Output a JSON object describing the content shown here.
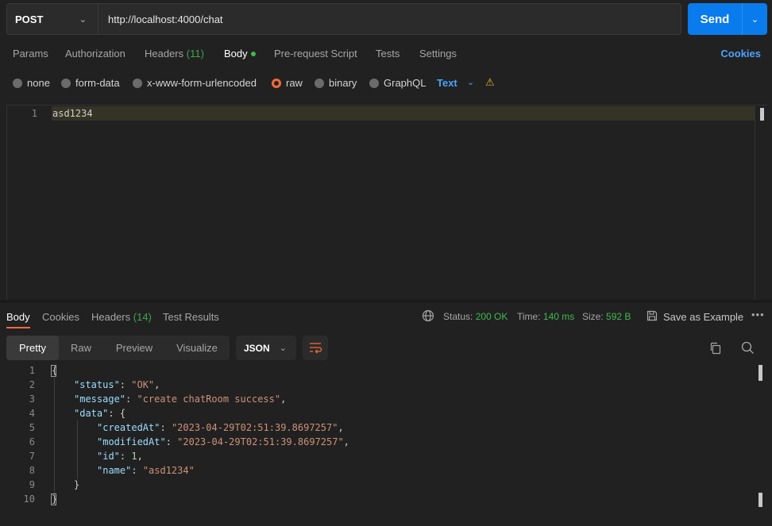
{
  "request": {
    "method": "POST",
    "url": "http://localhost:4000/chat",
    "send_label": "Send"
  },
  "request_tabs": [
    {
      "label": "Params"
    },
    {
      "label": "Authorization"
    },
    {
      "label": "Headers",
      "count": "(11)"
    },
    {
      "label": "Body"
    },
    {
      "label": "Pre-request Script"
    },
    {
      "label": "Tests"
    },
    {
      "label": "Settings"
    }
  ],
  "cookies_label": "Cookies",
  "body_types": [
    {
      "label": "none"
    },
    {
      "label": "form-data"
    },
    {
      "label": "x-www-form-urlencoded"
    },
    {
      "label": "raw"
    },
    {
      "label": "binary"
    },
    {
      "label": "GraphQL"
    }
  ],
  "body_format": "Text",
  "editor": {
    "line_numbers": [
      "1"
    ],
    "lines": [
      "asd1234"
    ]
  },
  "response_tabs": [
    {
      "label": "Body"
    },
    {
      "label": "Cookies"
    },
    {
      "label": "Headers",
      "count": "(14)"
    },
    {
      "label": "Test Results"
    }
  ],
  "response_meta": {
    "status_label": "Status:",
    "status_value": "200 OK",
    "time_label": "Time:",
    "time_value": "140 ms",
    "size_label": "Size:",
    "size_value": "592 B",
    "save_label": "Save as Example",
    "more": "•••"
  },
  "view_modes": [
    {
      "label": "Pretty"
    },
    {
      "label": "Raw"
    },
    {
      "label": "Preview"
    },
    {
      "label": "Visualize"
    }
  ],
  "response_format": "JSON",
  "response_body": {
    "line_numbers": [
      "1",
      "2",
      "3",
      "4",
      "5",
      "6",
      "7",
      "8",
      "9",
      "10"
    ],
    "l1": "{",
    "l2_key": "\"status\"",
    "l2_val": "\"OK\"",
    "l3_key": "\"message\"",
    "l3_val": "\"create chatRoom success\"",
    "l4_key": "\"data\"",
    "l4_open": "{",
    "l5_key": "\"createdAt\"",
    "l5_val": "\"2023-04-29T02:51:39.8697257\"",
    "l6_key": "\"modifiedAt\"",
    "l6_val": "\"2023-04-29T02:51:39.8697257\"",
    "l7_key": "\"id\"",
    "l7_val": "1",
    "l8_key": "\"name\"",
    "l8_val": "\"asd1234\"",
    "l9": "}",
    "l10": "}"
  },
  "colors": {
    "accent_blue": "#097bed",
    "accent_orange": "#f26b3a",
    "status_green": "#3fb950",
    "warning_yellow": "#e0b52d"
  }
}
